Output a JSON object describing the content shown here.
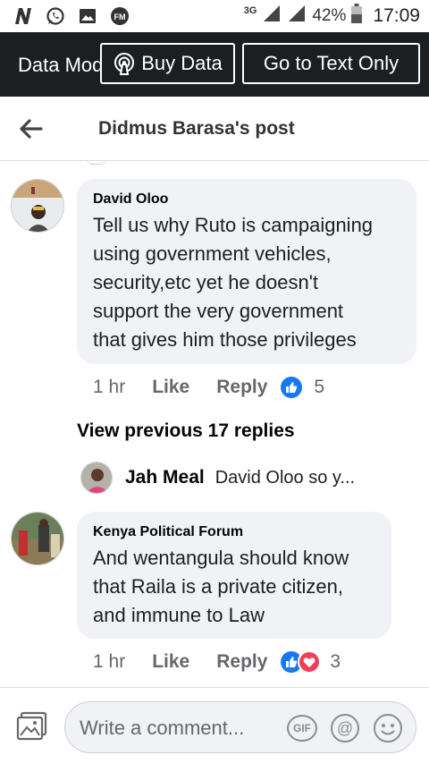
{
  "status_bar": {
    "signal_label": "3G",
    "battery": "42%",
    "time": "17:09",
    "icons": [
      "n-logo-icon",
      "whatsapp-icon",
      "gallery-icon",
      "fm-radio-icon",
      "signal-icon",
      "battery-icon"
    ]
  },
  "data_banner": {
    "mode_text": "Data Mode",
    "buy_data_label": "Buy Data",
    "text_only_label": "Go to Text Only"
  },
  "header": {
    "title": "Didmus Barasa's post",
    "back_icon": "arrow-left-icon"
  },
  "comments": [
    {
      "author": "David Oloo",
      "lines": [
        "Tell us why Ruto is campaigning",
        "using government vehicles,",
        "security,etc yet he doesn't",
        "support the very government",
        "that gives him those privileges"
      ],
      "time": "1 hr",
      "like_label": "Like",
      "reply_label": "Reply",
      "reaction_count": "5"
    },
    {
      "author": "Kenya Political Forum",
      "lines": [
        "And wentangula should know",
        "that Raila is a private citizen,",
        "and immune to Law"
      ],
      "time": "1 hr",
      "like_label": "Like",
      "reply_label": "Reply",
      "reaction_count": "3"
    }
  ],
  "view_previous": "View previous 17 replies",
  "reply_preview": {
    "name": "Jah Meal",
    "snippet": "David Oloo so y..."
  },
  "composer": {
    "placeholder": "Write a comment...",
    "gif_label": "GIF"
  },
  "colors": {
    "banner_bg": "#1c1e21",
    "bubble_bg": "#f0f2f5",
    "like_blue": "#1877f2",
    "love_red": "#f33e58"
  }
}
